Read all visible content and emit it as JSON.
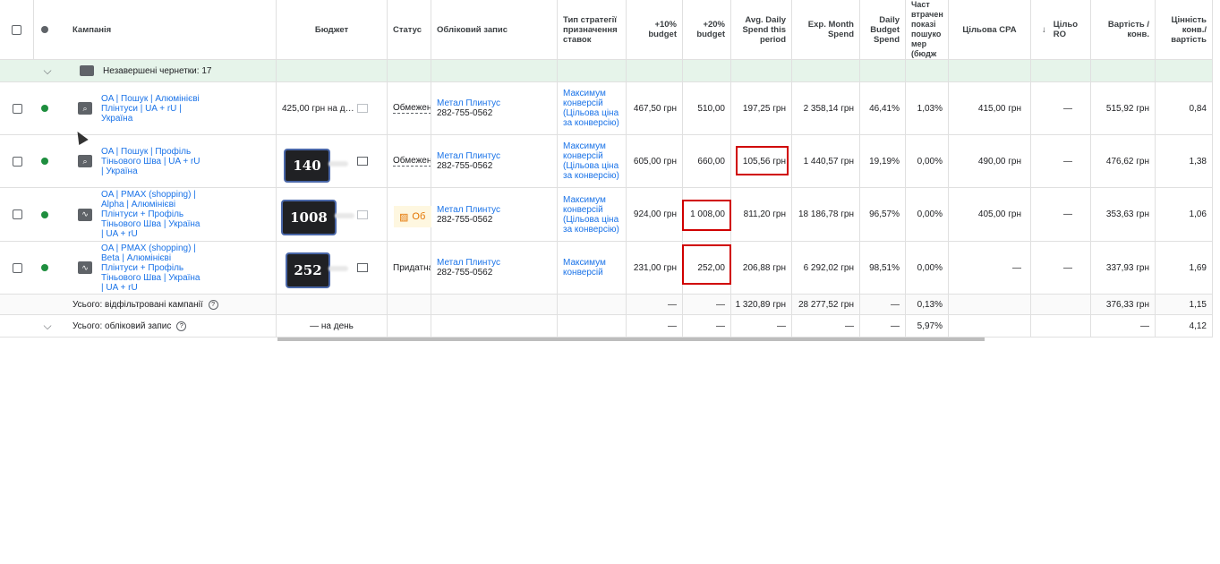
{
  "headers": {
    "campaign": "Кампанія",
    "budget": "Бюджет",
    "status": "Статус",
    "account": "Обліковий запис",
    "bid_strategy": "Тип стратегії призначення ставок",
    "plus10": "+10% budget",
    "plus20": "+20% budget",
    "avg_daily": "Avg. Daily Spend this period",
    "exp_month": "Exp. Month Spend",
    "daily_budget_spend": "Daily Budget Spend",
    "lost_share": "Част втрачен показі пошуко мер (бюдж",
    "target_cpa": "Цільова CPA",
    "target_roas": "Цільо RO",
    "cost_conv": "Вартість / конв.",
    "conv_value_cost": "Цінність конв./ вартість"
  },
  "draft_row": {
    "label": "Незавершені чернетки: 17"
  },
  "rows": [
    {
      "campaign": "OA | Пошук | Алюмінієві Плінтуси | UA + rU | Україна",
      "budget": "425,00 грн на д…",
      "status": "Обмежен",
      "account_name": "Метал Плинтус",
      "account_id": "282-755-0562",
      "strategy": "Максимум конверсій (Цільова ціна за конверсію)",
      "plus10": "467,50 грн",
      "plus20": "510,00",
      "avg_daily": "197,25 грн",
      "exp_month": "2 358,14 грн",
      "daily_budget_spend": "46,41%",
      "lost_share": "1,03%",
      "target_cpa": "415,00 грн",
      "target_roas": "—",
      "cost_conv": "515,92 грн",
      "conv_value_cost": "0,84"
    },
    {
      "campaign": "OA | Пошук | Профіль Тіньового Шва | UA + rU | Україна",
      "badge": "140",
      "status": "Обмежен",
      "account_name": "Метал Плинтус",
      "account_id": "282-755-0562",
      "strategy": "Максимум конверсій (Цільова ціна за конверсію)",
      "plus10": "605,00 грн",
      "plus20": "660,00",
      "avg_daily": "105,56 грн",
      "exp_month": "1 440,57 грн",
      "daily_budget_spend": "19,19%",
      "lost_share": "0,00%",
      "target_cpa": "490,00 грн",
      "target_roas": "—",
      "cost_conv": "476,62 грн",
      "conv_value_cost": "1,38"
    },
    {
      "campaign": "OA | PMAX (shopping) | Alpha | Алюмінієві Плінтуси + Профіль Тіньового Шва | Україна | UA + rU",
      "badge": "1008",
      "status": "Об",
      "account_name": "Метал Плинтус",
      "account_id": "282-755-0562",
      "strategy": "Максимум конверсій (Цільова ціна за конверсію)",
      "plus10": "924,00 грн",
      "plus20": "1 008,00",
      "avg_daily": "811,20 грн",
      "exp_month": "18 186,78 грн",
      "daily_budget_spend": "96,57%",
      "lost_share": "0,00%",
      "target_cpa": "405,00 грн",
      "target_roas": "—",
      "cost_conv": "353,63 грн",
      "conv_value_cost": "1,06"
    },
    {
      "campaign": "OA | PMAX (shopping) | Beta | Алюмінієві Плінтуси + Профіль Тіньового Шва | Україна | UA + rU",
      "badge": "252",
      "status": "Придатна",
      "account_name": "Метал Плинтус",
      "account_id": "282-755-0562",
      "strategy": "Максимум конверсій",
      "plus10": "231,00 грн",
      "plus20": "252,00",
      "avg_daily": "206,88 грн",
      "exp_month": "6 292,02 грн",
      "daily_budget_spend": "98,51%",
      "lost_share": "0,00%",
      "target_cpa": "—",
      "target_roas": "—",
      "cost_conv": "337,93 грн",
      "conv_value_cost": "1,69"
    }
  ],
  "totals_filtered": {
    "label": "Усього: відфільтровані кампанії",
    "plus10": "—",
    "plus20": "—",
    "avg_daily": "1 320,89 грн",
    "exp_month": "28 277,52 грн",
    "daily_budget_spend": "—",
    "lost_share": "0,13%",
    "cost_conv": "376,33 грн",
    "conv_value_cost": "1,15"
  },
  "totals_account": {
    "label": "Усього: обліковий запис",
    "budget": "— на день",
    "plus10": "—",
    "plus20": "—",
    "avg_daily": "—",
    "exp_month": "—",
    "daily_budget_spend": "—",
    "lost_share": "5,97%",
    "cost_conv": "—",
    "conv_value_cost": "4,12"
  }
}
